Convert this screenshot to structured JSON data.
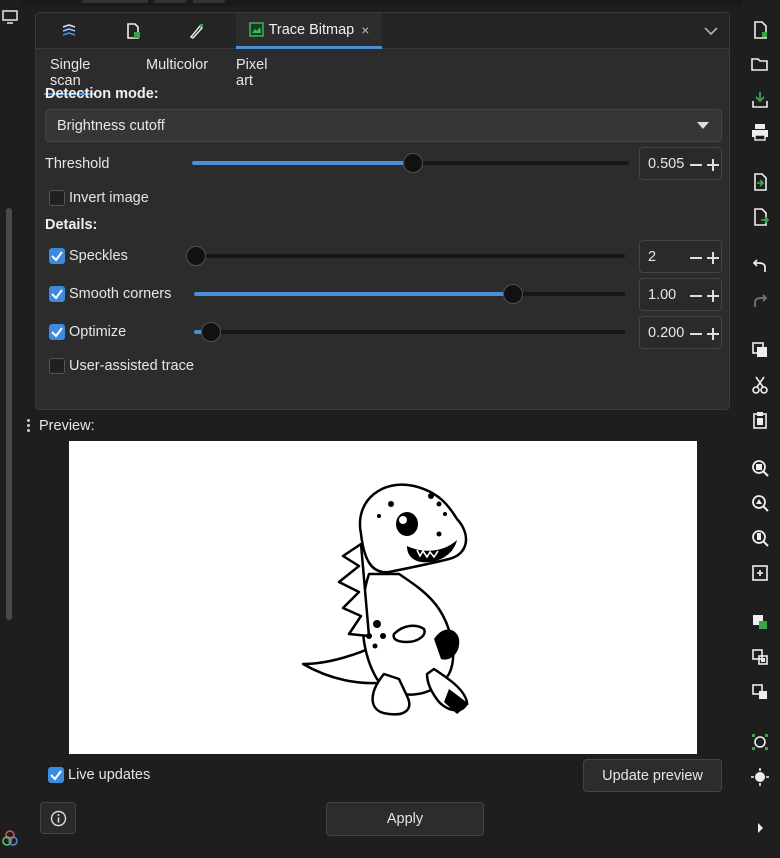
{
  "tabs": {
    "items": [
      {
        "icon": "layers-icon"
      },
      {
        "icon": "document-properties-icon"
      },
      {
        "icon": "edit-pen-icon"
      }
    ],
    "active_label": "Trace Bitmap",
    "close_glyph": "×"
  },
  "subtabs": [
    "Single scan",
    "Multicolor",
    "Pixel art"
  ],
  "detection": {
    "heading": "Detection mode:",
    "mode": "Brightness cutoff"
  },
  "threshold": {
    "label": "Threshold",
    "value": "0.505",
    "fraction": 0.505
  },
  "invert": {
    "label": "Invert image",
    "checked": false
  },
  "details": {
    "heading": "Details:",
    "speckles": {
      "label": "Speckles",
      "value": "2",
      "checked": true,
      "fraction": 0.0
    },
    "smooth_corners": {
      "label": "Smooth corners",
      "value": "1.00",
      "checked": true,
      "fraction": 0.74
    },
    "optimize": {
      "label": "Optimize",
      "value": "0.200",
      "checked": true,
      "fraction": 0.04
    },
    "user_assisted": {
      "label": "User-assisted trace",
      "checked": false
    }
  },
  "preview": {
    "label": "Preview:"
  },
  "live_updates": {
    "label": "Live updates",
    "checked": true
  },
  "update_preview_label": "Update preview",
  "apply_label": "Apply",
  "colors": {
    "accent": "#4a90d9",
    "panel": "#2c2c2c",
    "background": "#1e1e1e"
  }
}
